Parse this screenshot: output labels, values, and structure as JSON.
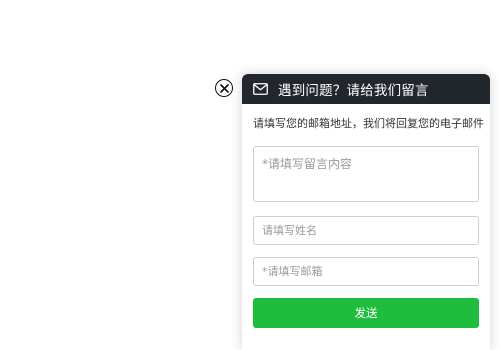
{
  "close": {
    "icon": "close-circle-icon"
  },
  "panel": {
    "header": {
      "icon": "mail-icon",
      "title": "遇到问题？请给我们留言",
      "background": "#22272d"
    },
    "hint": "请填写您的邮箱地址，我们将回复您的电子邮件",
    "message": {
      "placeholder": "*请填写留言内容",
      "value": ""
    },
    "name": {
      "placeholder": "请填写姓名",
      "value": ""
    },
    "email": {
      "placeholder": "*请填写邮箱",
      "value": ""
    },
    "send": {
      "label": "发送",
      "color": "#1fbd3e"
    }
  }
}
